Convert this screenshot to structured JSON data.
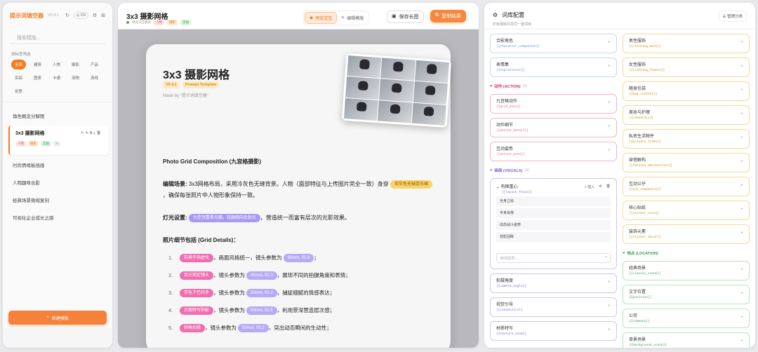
{
  "sidebar": {
    "app_title": "提示词填空器",
    "version": "V0.4.1",
    "lang": "CN",
    "search_placeholder": "搜索模版...",
    "filter_label": "按标签筛选",
    "filters": [
      "全部",
      "建筑",
      "人物",
      "摄影",
      "产品",
      "实拍",
      "图表",
      "卡通",
      "宠物",
      "游戏",
      "创意"
    ],
    "templates": [
      "角色概念分解图",
      "3x3 摄影网格",
      "时尚情绪板插画",
      "人物趣味合影",
      "经典场景微缩复刻",
      "可视化企业成长之路"
    ],
    "selected_tags": [
      "人物",
      "摄影",
      "实拍"
    ],
    "new_button": "新建模版"
  },
  "editor": {
    "title": "3x3 摄影网格",
    "status": "预览交互模式",
    "tags": [
      "人物",
      "摄影",
      "实拍"
    ],
    "mode_preview": "预览交互",
    "mode_edit": "编辑模版",
    "save_long": "保存长图",
    "copy_result": "复制结果"
  },
  "card": {
    "title": "3x3 摄影网格",
    "version": "V0.4.1",
    "badge": "Prompt Template",
    "made_by": "Made by \"提示词填空器\"",
    "section_title": "Photo Grid Composition (九宫格摄影)",
    "scene_label": "编辑场景:",
    "scene_text": "3x3网格布局，采用冷灰色无缝背景。人物（面部特征与上传图片完全一致）身穿",
    "scene_fill": "炭灰色无袖连衣裙",
    "scene_text2": "，确保每张照片中人物形象保持一致。",
    "light_label": "灯光设置:",
    "light_fill": "大型顶置柔光箱，轻微侧向反射光",
    "light_text": "，营造统一而富有层次的光影效果。",
    "details_title": "照片细节包括 (Grid Details)：",
    "details": [
      {
        "num": "1.",
        "pose": "前景手指虚化",
        "mid": "，画面风格统一，镜头参数为",
        "lens": "85mm, f/1.8",
        "tail": "；"
      },
      {
        "num": "2.",
        "pose": "目光锁定镜头",
        "mid": "，镜头参数为",
        "lens": "85mm, f/2.0",
        "tail": "，展现不同的拍摄角度和表情；"
      },
      {
        "num": "3.",
        "pose": "单色下巴托手",
        "mid": "，镜头参数为",
        "lens": "50mm, f/2.2",
        "tail": "，捕捉细腻的情感表达；"
      },
      {
        "num": "4.",
        "pose": "正面特写阴影",
        "mid": "，镜头参数为",
        "lens": "50mm, f/2.5",
        "tail": "，利用景深营造层次感；"
      },
      {
        "num": "5.",
        "pose": "斜角拍摄",
        "mid": "，镜头参数为",
        "lens": "50mm, f/3.2",
        "tail": "，突出动态瞬间的生动性；"
      }
    ]
  },
  "library": {
    "title": "词库配置",
    "subtitle": "所有模版共享同一套词库",
    "manage": "管理分类",
    "col1_top": [
      {
        "name": "合影角色",
        "var": "{{character_companion}}"
      },
      {
        "name": "表情集",
        "var": "{{expressions}}"
      }
    ],
    "action_cat": "动作 (ACTION)",
    "action_count": "(3)",
    "action_items": [
      {
        "name": "九宫格动作",
        "var": "{{grid_pose}}"
      },
      {
        "name": "动作细节",
        "var": "{{action_detail}}"
      },
      {
        "name": "互动姿势",
        "var": "{{action_pose}}"
      }
    ],
    "visual_cat": "画面 (VISUALS)",
    "visual_count": "(9)",
    "expanded": {
      "name": "构图重心",
      "var": "{{layout_focus}}",
      "insert": "插入",
      "options": [
        "全身立绘",
        "半身肖像",
        "动态战斗姿势",
        "背影回眸"
      ],
      "new_placeholder": "新增选项..."
    },
    "visual_items": [
      {
        "name": "拍摄角度",
        "var": "{{camera_angle}}"
      },
      {
        "name": "视觉引导",
        "var": "{{connectors}}"
      },
      {
        "name": "材质特写",
        "var": "{{texture_zoom}}"
      }
    ],
    "col2_items": [
      {
        "name": "男性服饰",
        "var": "{{clothing_male}}"
      },
      {
        "name": "女性服饰",
        "var": "{{clothing_female}}"
      },
      {
        "name": "随身包袋",
        "var": "{{bag_content}}"
      },
      {
        "name": "美妆与护理",
        "var": "{{cosmetics}}"
      },
      {
        "name": "私密生活物件",
        "var": "{{private_items}}"
      },
      {
        "name": "穿搭解构",
        "var": "{{fashion_deconstruct}}"
      },
      {
        "name": "互动公仔",
        "var": "{{toy_companion}}"
      },
      {
        "name": "核心贴纸",
        "var": "{{sticker_core}}"
      },
      {
        "name": "装饰元素",
        "var": "{{sticker_decor}}"
      }
    ],
    "location_cat": "地点 (LOCATION)",
    "location_items": [
      {
        "name": "经典场景",
        "var": "{{classic_scene}}"
      },
      {
        "name": "文字位置",
        "var": "{{position}}"
      },
      {
        "name": "公司",
        "var": "{{company}}"
      },
      {
        "name": "背景场景",
        "var": "{{background_scene}}"
      }
    ]
  }
}
